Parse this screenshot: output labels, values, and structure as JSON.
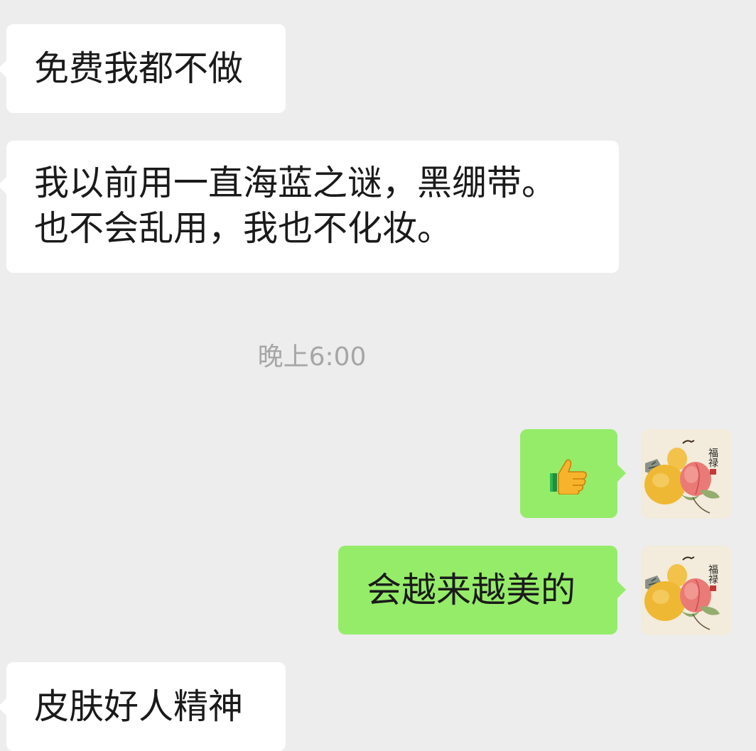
{
  "chat": {
    "messages": [
      {
        "side": "in",
        "text": "免费我都不做"
      },
      {
        "side": "in",
        "text": "我以前用一直海蓝之谜，黑绷带。\n也不会乱用，我也不化妆。"
      },
      {
        "side": "out",
        "emoji": "thumbs-up",
        "text": ""
      },
      {
        "side": "out",
        "text": "会越来越美的"
      },
      {
        "side": "in",
        "text": "皮肤好人精神"
      }
    ],
    "timestamp": "晚上6:00"
  },
  "avatar": {
    "seal_text": "福禄",
    "icon": "fruit-painting-avatar"
  },
  "colors": {
    "background": "#ededed",
    "incoming_bubble": "#ffffff",
    "outgoing_bubble": "#95ec69",
    "timestamp_text": "#a6a6a6"
  }
}
